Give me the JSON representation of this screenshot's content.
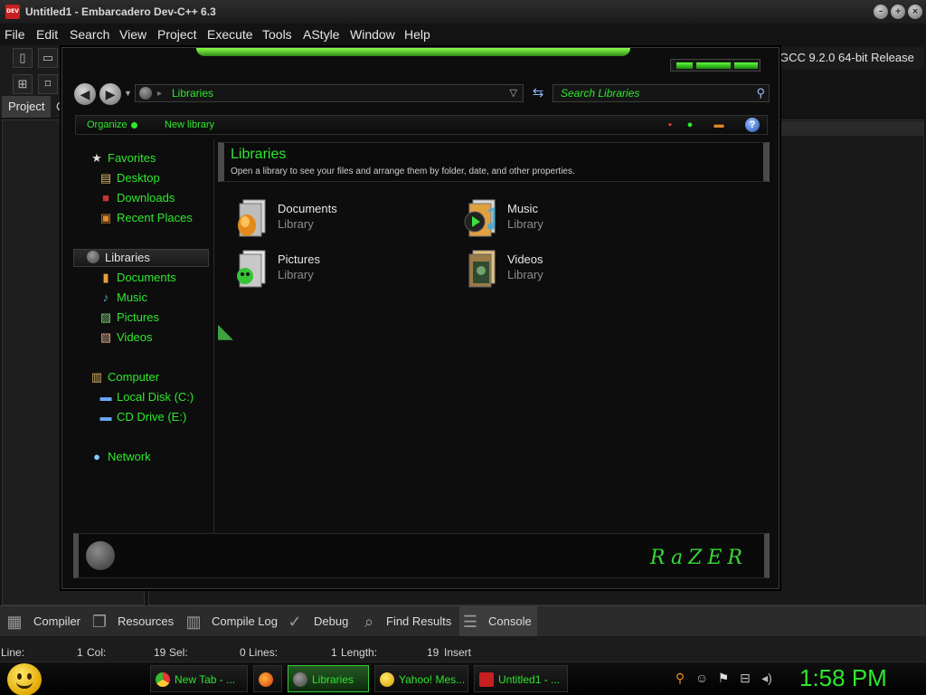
{
  "ide": {
    "title": "Untitled1 - Embarcadero Dev-C++ 6.3",
    "menu": [
      "File",
      "Edit",
      "Search",
      "View",
      "Project",
      "Execute",
      "Tools",
      "AStyle",
      "Window",
      "Help"
    ],
    "compiler": "GCC 9.2.0 64-bit Release",
    "project_tab": "Project",
    "project_tab_cut": "C",
    "bottom_tabs": [
      "Compiler",
      "Resources",
      "Compile Log",
      "Debug",
      "Find Results",
      "Console"
    ],
    "status": {
      "line_label": "Line:",
      "line_value": "1",
      "col_label": "Col:",
      "col_value": "19",
      "sel_label": "Sel:",
      "sel_value": "0",
      "lines_label": "Lines:",
      "lines_value": "1",
      "length_label": "Length:",
      "length_value": "19",
      "mode": "Insert"
    }
  },
  "explorer": {
    "address_path": "Libraries",
    "search_placeholder": "Search Libraries",
    "commands": {
      "organize": "Organize",
      "new_library": "New library"
    },
    "nav": {
      "favorites": "Favorites",
      "desktop": "Desktop",
      "downloads": "Downloads",
      "recent_places": "Recent Places",
      "libraries": "Libraries",
      "documents": "Documents",
      "music": "Music",
      "pictures": "Pictures",
      "videos": "Videos",
      "computer": "Computer",
      "local_disk": "Local Disk (C:)",
      "cd_drive": "CD Drive (E:)",
      "network": "Network"
    },
    "header": {
      "title": "Libraries",
      "subtitle": "Open a library to see your files and arrange them by folder, date, and other properties."
    },
    "libraries": [
      {
        "name": "Documents",
        "type": "Library"
      },
      {
        "name": "Music",
        "type": "Library"
      },
      {
        "name": "Pictures",
        "type": "Library"
      },
      {
        "name": "Videos",
        "type": "Library"
      }
    ],
    "brand": "RaZER"
  },
  "taskbar": {
    "tasks": [
      {
        "label": "New Tab - ..."
      },
      {
        "label": ""
      },
      {
        "label": "Libraries"
      },
      {
        "label": "Yahoo! Mes..."
      },
      {
        "label": "Untitled1 - ..."
      }
    ],
    "clock": "1:58 PM"
  },
  "colors": {
    "accent_green": "#2ee82e",
    "window_bg": "#0d0d0d",
    "taskbar_bg": "#000000"
  }
}
